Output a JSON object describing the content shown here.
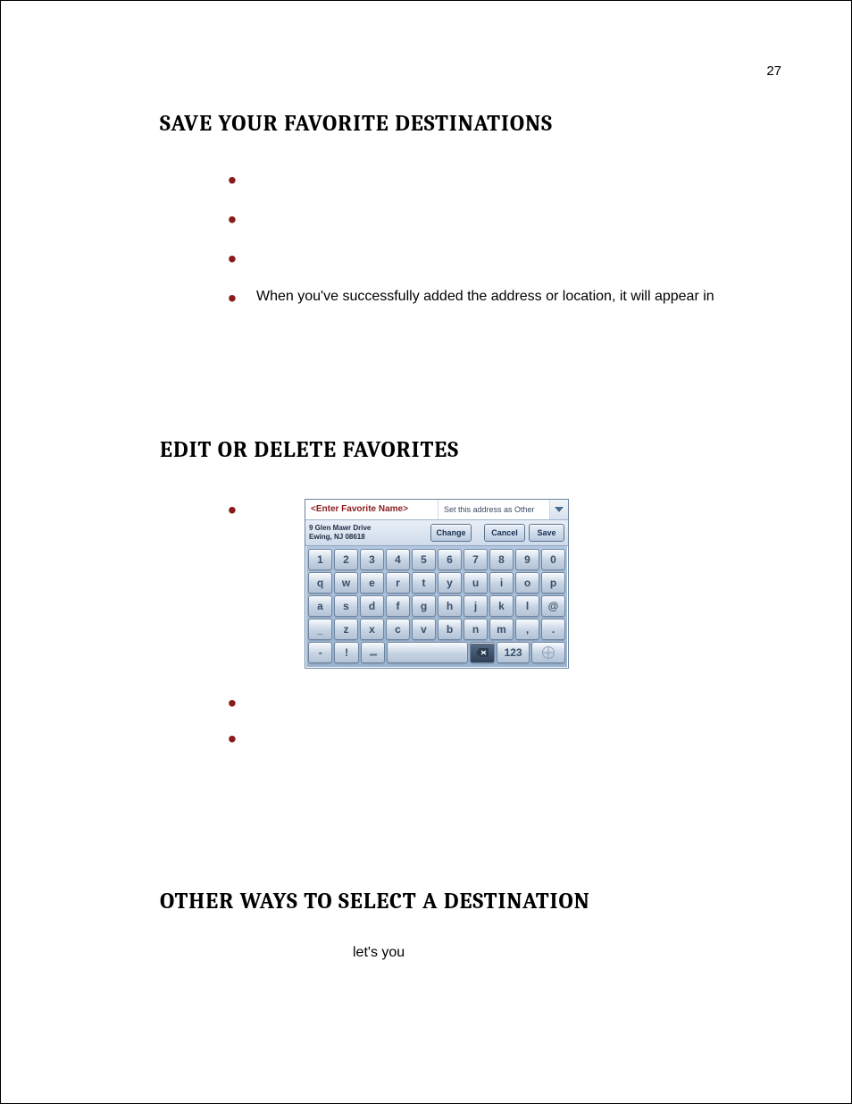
{
  "page_number": "27",
  "headings": {
    "h1": "SAVE YOUR FAVORITE DESTINATIONS",
    "h2": "EDIT OR DELETE FAVORITES",
    "h3": "OTHER WAYS TO SELECT A DESTINATION"
  },
  "section1": {
    "bullets": [
      "",
      "",
      "",
      "When you've successfully added the address or location, it will appear in"
    ]
  },
  "section2": {
    "bullets": [
      "",
      "",
      ""
    ]
  },
  "para_fragment": "let's you",
  "keyboard": {
    "name_placeholder": "<Enter Favorite Name>",
    "set_as_label": "Set this address as Other",
    "address_line1": "9 Glen Mawr Drive",
    "address_line2": "Ewing, NJ 08618",
    "buttons": {
      "change": "Change",
      "cancel": "Cancel",
      "save": "Save"
    },
    "rows": {
      "r1": [
        "1",
        "2",
        "3",
        "4",
        "5",
        "6",
        "7",
        "8",
        "9",
        "0"
      ],
      "r2": [
        "q",
        "w",
        "e",
        "r",
        "t",
        "y",
        "u",
        "i",
        "o",
        "p"
      ],
      "r3": [
        "a",
        "s",
        "d",
        "f",
        "g",
        "h",
        "j",
        "k",
        "l",
        "@"
      ],
      "r4": [
        "_",
        "z",
        "x",
        "c",
        "v",
        "b",
        "n",
        "m",
        ",",
        "."
      ],
      "r5": {
        "dash": "-",
        "bang": "!",
        "num": "123"
      }
    }
  }
}
